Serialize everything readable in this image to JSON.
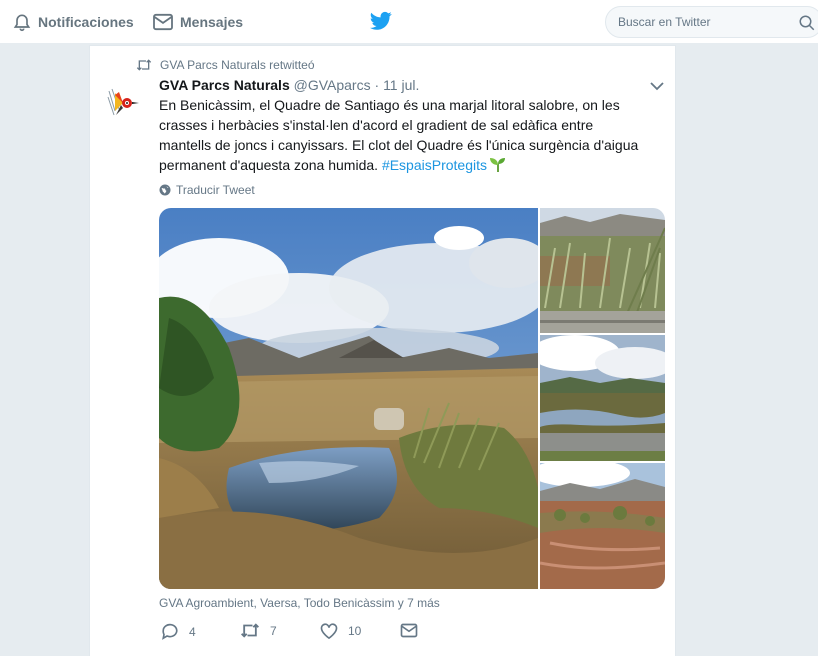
{
  "nav": {
    "notifications_label": "Notificaciones",
    "messages_label": "Mensajes",
    "search_placeholder": "Buscar en Twitter"
  },
  "tweet": {
    "retweet_context": "GVA Parcs Naturals retwitteó",
    "author_name": "GVA Parcs Naturals",
    "author_handle": "@GVAparcs",
    "separator": "·",
    "timestamp": "11 jul.",
    "text": "En Benicàssim, el Quadre de Santiago és una marjal litoral salobre, on les crasses i herbàcies s'instal·len d'acord el gradient de sal edàfica entre mantells de joncs i canyissars. El clot del Quadre és l'única surgència d'aigua permanent d'aquesta zona humida. ",
    "hashtag": "#EspaisProtegits",
    "translate_label": "Traducir Tweet",
    "tagged_people": "GVA Agroambient, Vaersa, Todo Benicàssim y 7 más",
    "reply_count": "4",
    "retweet_count": "7",
    "like_count": "10"
  },
  "colors": {
    "twitter_blue": "#1da1f2",
    "link_blue": "#1b95e0",
    "muted_gray": "#657786",
    "background": "#e6ecf0"
  },
  "icons": [
    "bell-icon",
    "envelope-icon",
    "twitter-bird-icon",
    "search-icon",
    "retweet-icon",
    "chevron-down-icon",
    "globe-icon",
    "reply-icon",
    "heart-icon",
    "direct-message-icon",
    "sprout-emoji-icon"
  ]
}
